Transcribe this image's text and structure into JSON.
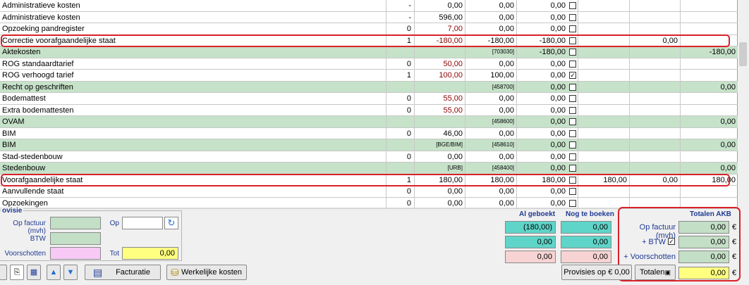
{
  "rows": [
    {
      "name": "Administratieve kosten",
      "q": "-",
      "p": "0,00",
      "t": "0,00",
      "v": "0,00",
      "cb": false
    },
    {
      "name": "Administratieve kosten",
      "q": "-",
      "p": "596,00",
      "t": "0,00",
      "v": "0,00",
      "cb": false
    },
    {
      "name": "Opzoeking pandregister",
      "q": "0",
      "p": "7,00",
      "t": "0,00",
      "v": "0,00",
      "cb": false
    },
    {
      "name": "Correctie voorafgaandelijke staat",
      "q": "1",
      "p": "-180,00",
      "t": "-180,00",
      "v": "-180,00",
      "cb": false,
      "g2": "0,00"
    },
    {
      "name": "Aktekosten",
      "t": "[703030]",
      "v": "-180,00",
      "cb": false,
      "g3": "-180,00"
    },
    {
      "name": "ROG standaardtarief",
      "q": "0",
      "p": "50,00",
      "t": "0,00",
      "v": "0,00",
      "cb": false
    },
    {
      "name": "ROG verhoogd tarief",
      "q": "1",
      "p": "100,00",
      "t": "100,00",
      "v": "0,00",
      "cb": true
    },
    {
      "name": "Recht op geschriften",
      "t": "[458700]",
      "v": "0,00",
      "cb": false,
      "g3": "0,00"
    },
    {
      "name": "Bodemattest",
      "q": "0",
      "p": "55,00",
      "t": "0,00",
      "v": "0,00",
      "cb": false
    },
    {
      "name": "Extra bodemattesten",
      "q": "0",
      "p": "55,00",
      "t": "0,00",
      "v": "0,00",
      "cb": false
    },
    {
      "name": "OVAM",
      "t": "[458600]",
      "v": "0,00",
      "cb": false,
      "g3": "0,00"
    },
    {
      "name": "BIM",
      "q": "0",
      "p": "46,00",
      "t": "0,00",
      "v": "0,00",
      "cb": false
    },
    {
      "name": "BIM",
      "p": "[BGE/BIM]",
      "t": "[458610]",
      "v": "0,00",
      "cb": false,
      "g3": "0,00"
    },
    {
      "name": "Stad-stedenbouw",
      "q": "0",
      "p": "0,00",
      "t": "0,00",
      "v": "0,00",
      "cb": false
    },
    {
      "name": "Stedenbouw",
      "p": "[URB]",
      "t": "[458400]",
      "v": "0,00",
      "cb": false,
      "g3": "0,00"
    },
    {
      "name": "Voorafgaandelijke staat",
      "q": "1",
      "p": "180,00",
      "t": "180,00",
      "v": "180,00",
      "cb": false,
      "g1": "180,00",
      "g2": "0,00",
      "g3": "180,00"
    },
    {
      "name": "Aanvullende staat",
      "q": "0",
      "p": "0,00",
      "t": "0,00",
      "v": "0,00",
      "cb": false
    },
    {
      "name": "Opzoekingen",
      "q": "0",
      "p": "0,00",
      "t": "0,00",
      "v": "0,00",
      "cb": false
    }
  ],
  "provisie": {
    "legend": "ovisie",
    "op_factuur_label": "Op factuur (mvh)",
    "btw_label": "BTW",
    "voorschotten_label": "Voorschotten",
    "op_label": "Op",
    "tot_label": "Tot",
    "tot_value": "0,00"
  },
  "booking": {
    "al_geboekt_label": "Al geboekt",
    "nog_te_boeken_label": "Nog te boeken",
    "al_values": [
      "(180,00)",
      "0,00",
      "0,00"
    ],
    "nog_values": [
      "0,00",
      "0,00",
      "0,00"
    ]
  },
  "akb": {
    "title": "Totalen AKB",
    "op_factuur_label": "Op factuur (mvh)",
    "btw_label": "+ BTW",
    "voorschotten_label": "+ Voorschotten",
    "totalen_label": "Totalen",
    "values": [
      "0,00",
      "0,00",
      "0,00",
      "0,00"
    ],
    "currency": "€"
  },
  "toolbar": {
    "facturatie": "Facturatie",
    "werkelijke_kosten": "Werkelijke kosten",
    "provisies": "Provisies op € 0,00"
  }
}
